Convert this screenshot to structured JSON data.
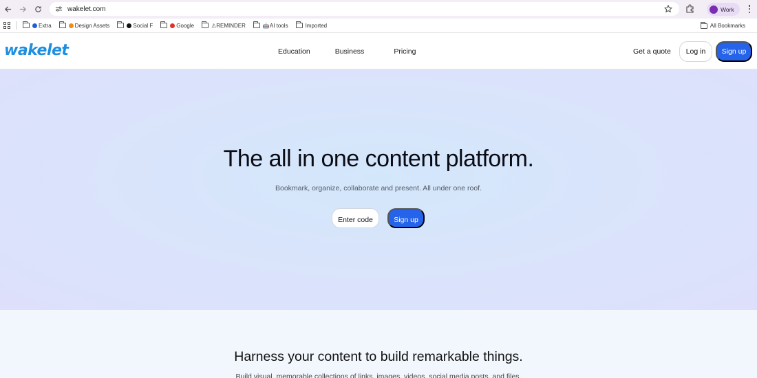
{
  "browser": {
    "url": "wakelet.com",
    "profile_name": "Work",
    "colors": {
      "profile_dot": "#7a2db3",
      "bar_bg": "#f3eef6"
    }
  },
  "bookmarks": {
    "items": [
      {
        "label": "Extra",
        "dot_color": "#1f5fd6"
      },
      {
        "label": "Design Assets",
        "dot_color": "#f08a1c"
      },
      {
        "label": "Social F",
        "dot_color": "#111111"
      },
      {
        "label": "Google",
        "dot_color": "#e0312b"
      },
      {
        "label": "⚠REMINDER",
        "dot_color": ""
      },
      {
        "label": "🤖AI tools",
        "dot_color": ""
      },
      {
        "label": "Imported",
        "dot_color": ""
      }
    ],
    "all_label": "All Bookmarks"
  },
  "header": {
    "logo_text": "wakelet",
    "nav": [
      "Education",
      "Business",
      "Pricing"
    ],
    "quote_label": "Get a quote",
    "login_label": "Log in",
    "signup_label": "Sign up",
    "colors": {
      "brand": "#1d8fe0",
      "primary_button": "#2563eb"
    }
  },
  "hero": {
    "title": "The all in one content platform.",
    "subtitle": "Bookmark, organize, collaborate and present. All under one roof.",
    "enter_code_label": "Enter code",
    "signup_label": "Sign up"
  },
  "section2": {
    "title": "Harness your content to build remarkable things.",
    "subtitle": "Build visual, memorable collections of links, images, videos, social media posts, and files."
  }
}
